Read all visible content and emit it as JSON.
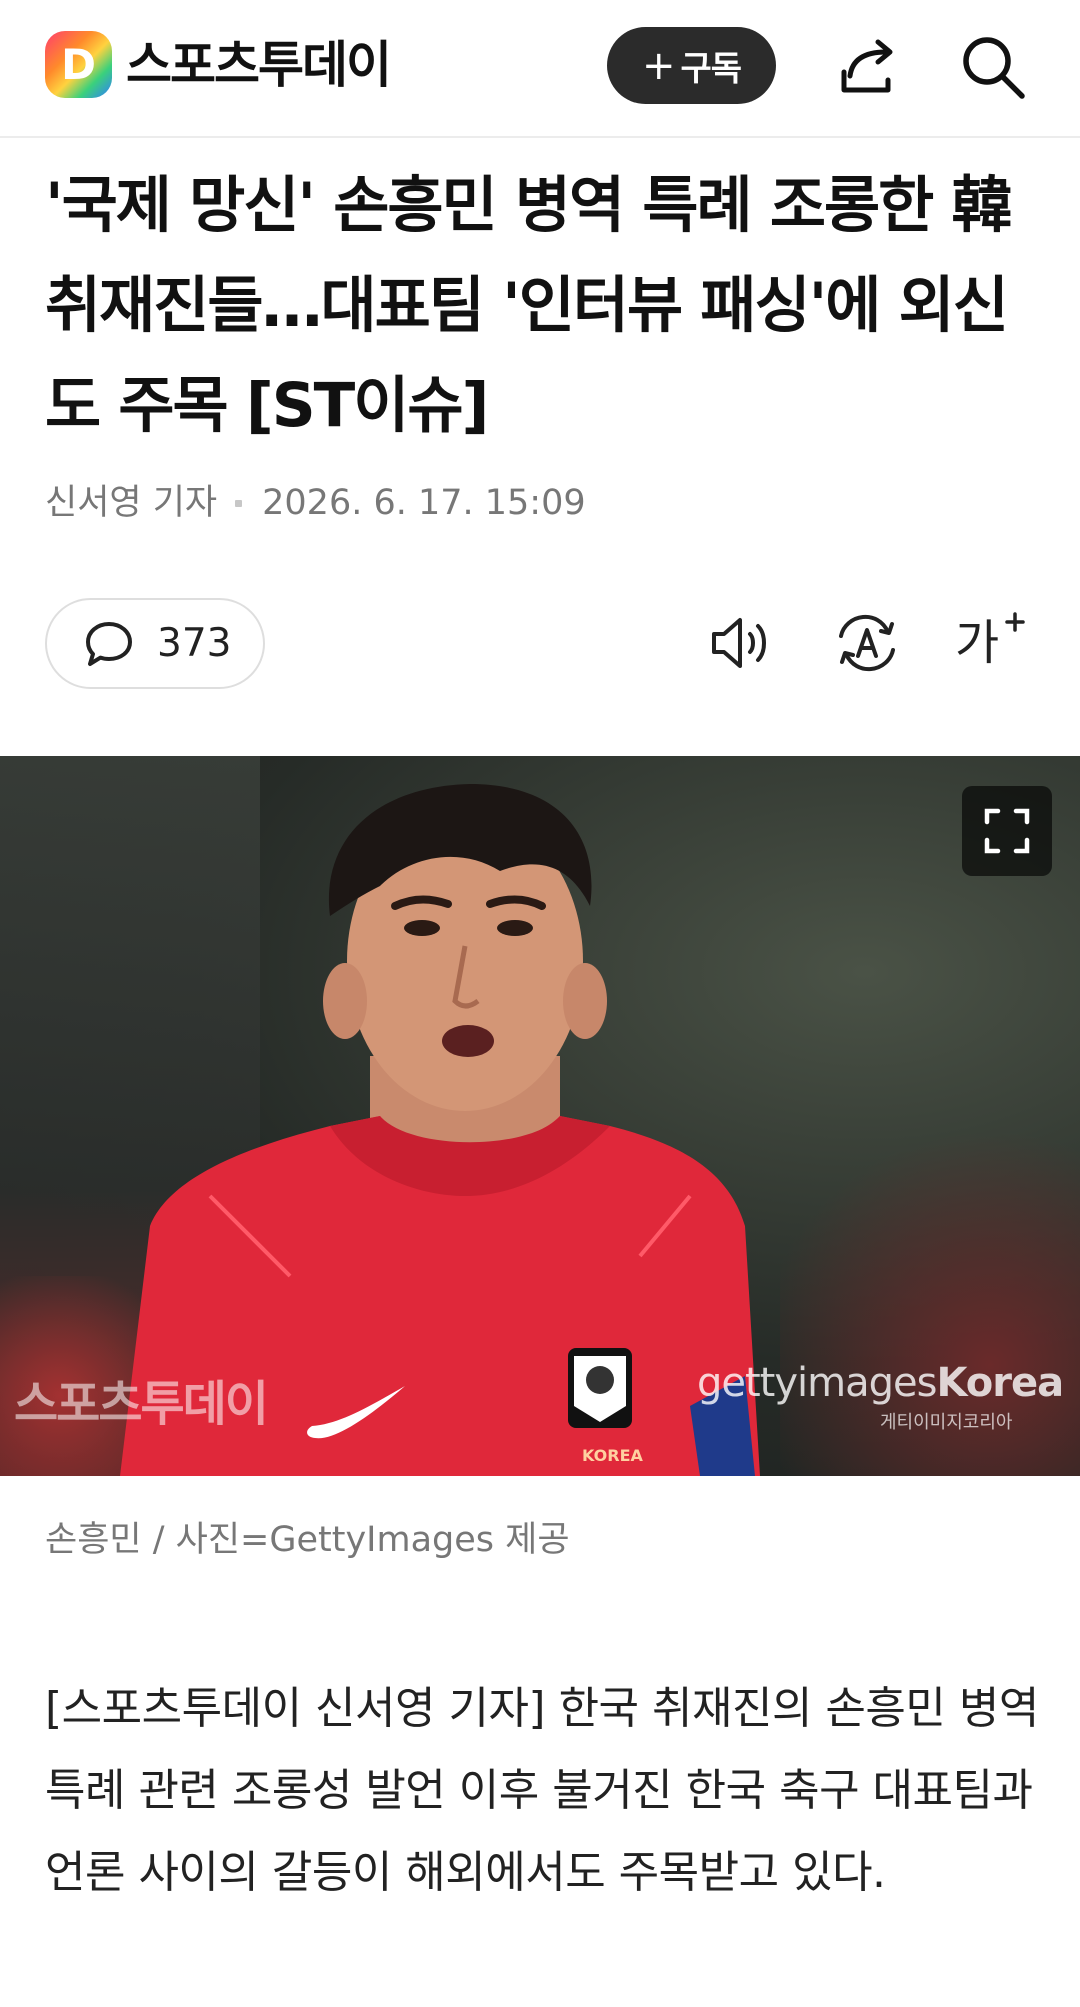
{
  "header": {
    "logo_letter": "D",
    "brand": "스포츠투데이",
    "subscribe_plus": "+",
    "subscribe_label": "구독"
  },
  "article": {
    "headline": "'국제 망신' 손흥민 병역 특례 조롱한 韓 취재진들…대표팀 '인터뷰 패싱'에 외신도 주목 [ST이슈]",
    "reporter": "신서영 기자",
    "datetime": "2026. 6. 17. 15:09",
    "comment_count": "373",
    "font_size_label": "가",
    "photo": {
      "watermark_left": "스포츠투데이",
      "getty_light": "getty",
      "getty_mid": "images",
      "getty_bold": "Korea",
      "getty_sub": "게티이미지코리아",
      "jersey_text": "KOREA"
    },
    "caption": "손흥민 / 사진=GettyImages 제공",
    "body": "[스포츠투데이 신서영 기자] 한국 취재진의 손흥민 병역 특례 관련 조롱성 발언 이후 불거진 한국 축구 대표팀과 언론 사이의 갈등이 해외에서도 주목받고 있다."
  },
  "icons": {
    "share": "share-icon",
    "search": "search-icon",
    "comment": "comment-icon",
    "speaker": "speaker-icon",
    "translate": "translate-icon",
    "expand": "expand-icon"
  },
  "colors": {
    "subscribe_bg": "#2b2b2b",
    "meta_text": "#777777",
    "jersey_red": "#e0283a"
  }
}
